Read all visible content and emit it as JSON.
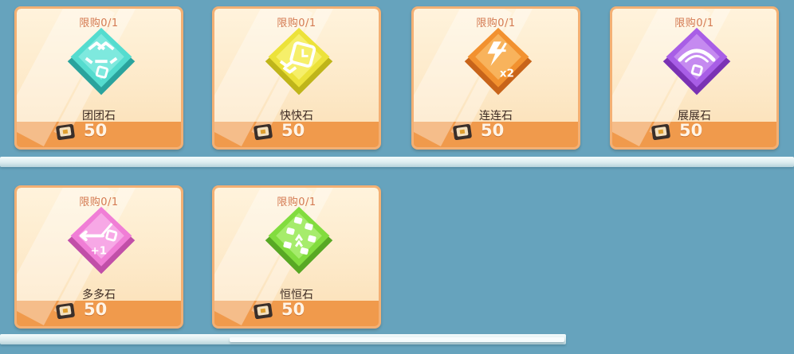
{
  "shop": {
    "items": [
      {
        "limit": "限购0/1",
        "name": "团团石",
        "price": "50",
        "icon": "teal-stone-icon",
        "color": "#4fd3c9"
      },
      {
        "limit": "限购0/1",
        "name": "快快石",
        "price": "50",
        "icon": "yellow-stone-icon",
        "color": "#e5dc2c"
      },
      {
        "limit": "限购0/1",
        "name": "连连石",
        "price": "50",
        "icon": "orange-stone-icon",
        "color": "#f08a2e"
      },
      {
        "limit": "限购0/1",
        "name": "展展石",
        "price": "50",
        "icon": "purple-stone-icon",
        "color": "#a655e0"
      },
      {
        "limit": "限购0/1",
        "name": "多多石",
        "price": "50",
        "icon": "pink-stone-icon",
        "color": "#f07ed6"
      },
      {
        "limit": "限购0/1",
        "name": "恒恒石",
        "price": "50",
        "icon": "green-stone-icon",
        "color": "#7fd93b"
      }
    ]
  }
}
